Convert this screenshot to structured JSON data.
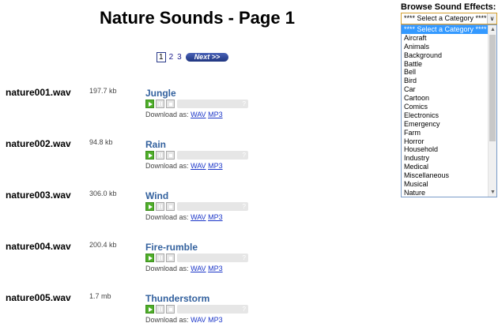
{
  "page": {
    "title": "Nature Sounds - Page 1"
  },
  "pager": {
    "pages": [
      {
        "label": "1",
        "current": true
      },
      {
        "label": "2",
        "current": false
      },
      {
        "label": "3",
        "current": false
      }
    ],
    "next_label": "Next >>"
  },
  "download_label": "Download as:",
  "sounds": [
    {
      "file": "nature001.wav",
      "size": "197.7 kb",
      "title": "Jungle",
      "formats": [
        "WAV",
        "MP3"
      ]
    },
    {
      "file": "nature002.wav",
      "size": "94.8 kb",
      "title": "Rain",
      "formats": [
        "WAV",
        "MP3"
      ]
    },
    {
      "file": "nature003.wav",
      "size": "306.0 kb",
      "title": "Wind",
      "formats": [
        "WAV",
        "MP3"
      ]
    },
    {
      "file": "nature004.wav",
      "size": "200.4 kb",
      "title": "Fire-rumble",
      "formats": [
        "WAV",
        "MP3"
      ]
    },
    {
      "file": "nature005.wav",
      "size": "1.7 mb",
      "title": "Thunderstorm",
      "formats": [
        "WAV",
        "MP3"
      ]
    }
  ],
  "player": {
    "help_glyph": "?"
  },
  "browse": {
    "label": "Browse Sound Effects:",
    "selected": "**** Select a Category ****",
    "options": [
      "**** Select a Category ****",
      "Aircraft",
      "Animals",
      "Background",
      "Battle",
      "Bell",
      "Bird",
      "Car",
      "Cartoon",
      "Comics",
      "Electronics",
      "Emergency",
      "Farm",
      "Horror",
      "Household",
      "Industry",
      "Medical",
      "Miscellaneous",
      "Musical",
      "Nature"
    ]
  },
  "colors": {
    "title_link": "#33619e",
    "play_green": "#4fae2a",
    "selection": "#3399ff",
    "link": "#1a35c8"
  }
}
